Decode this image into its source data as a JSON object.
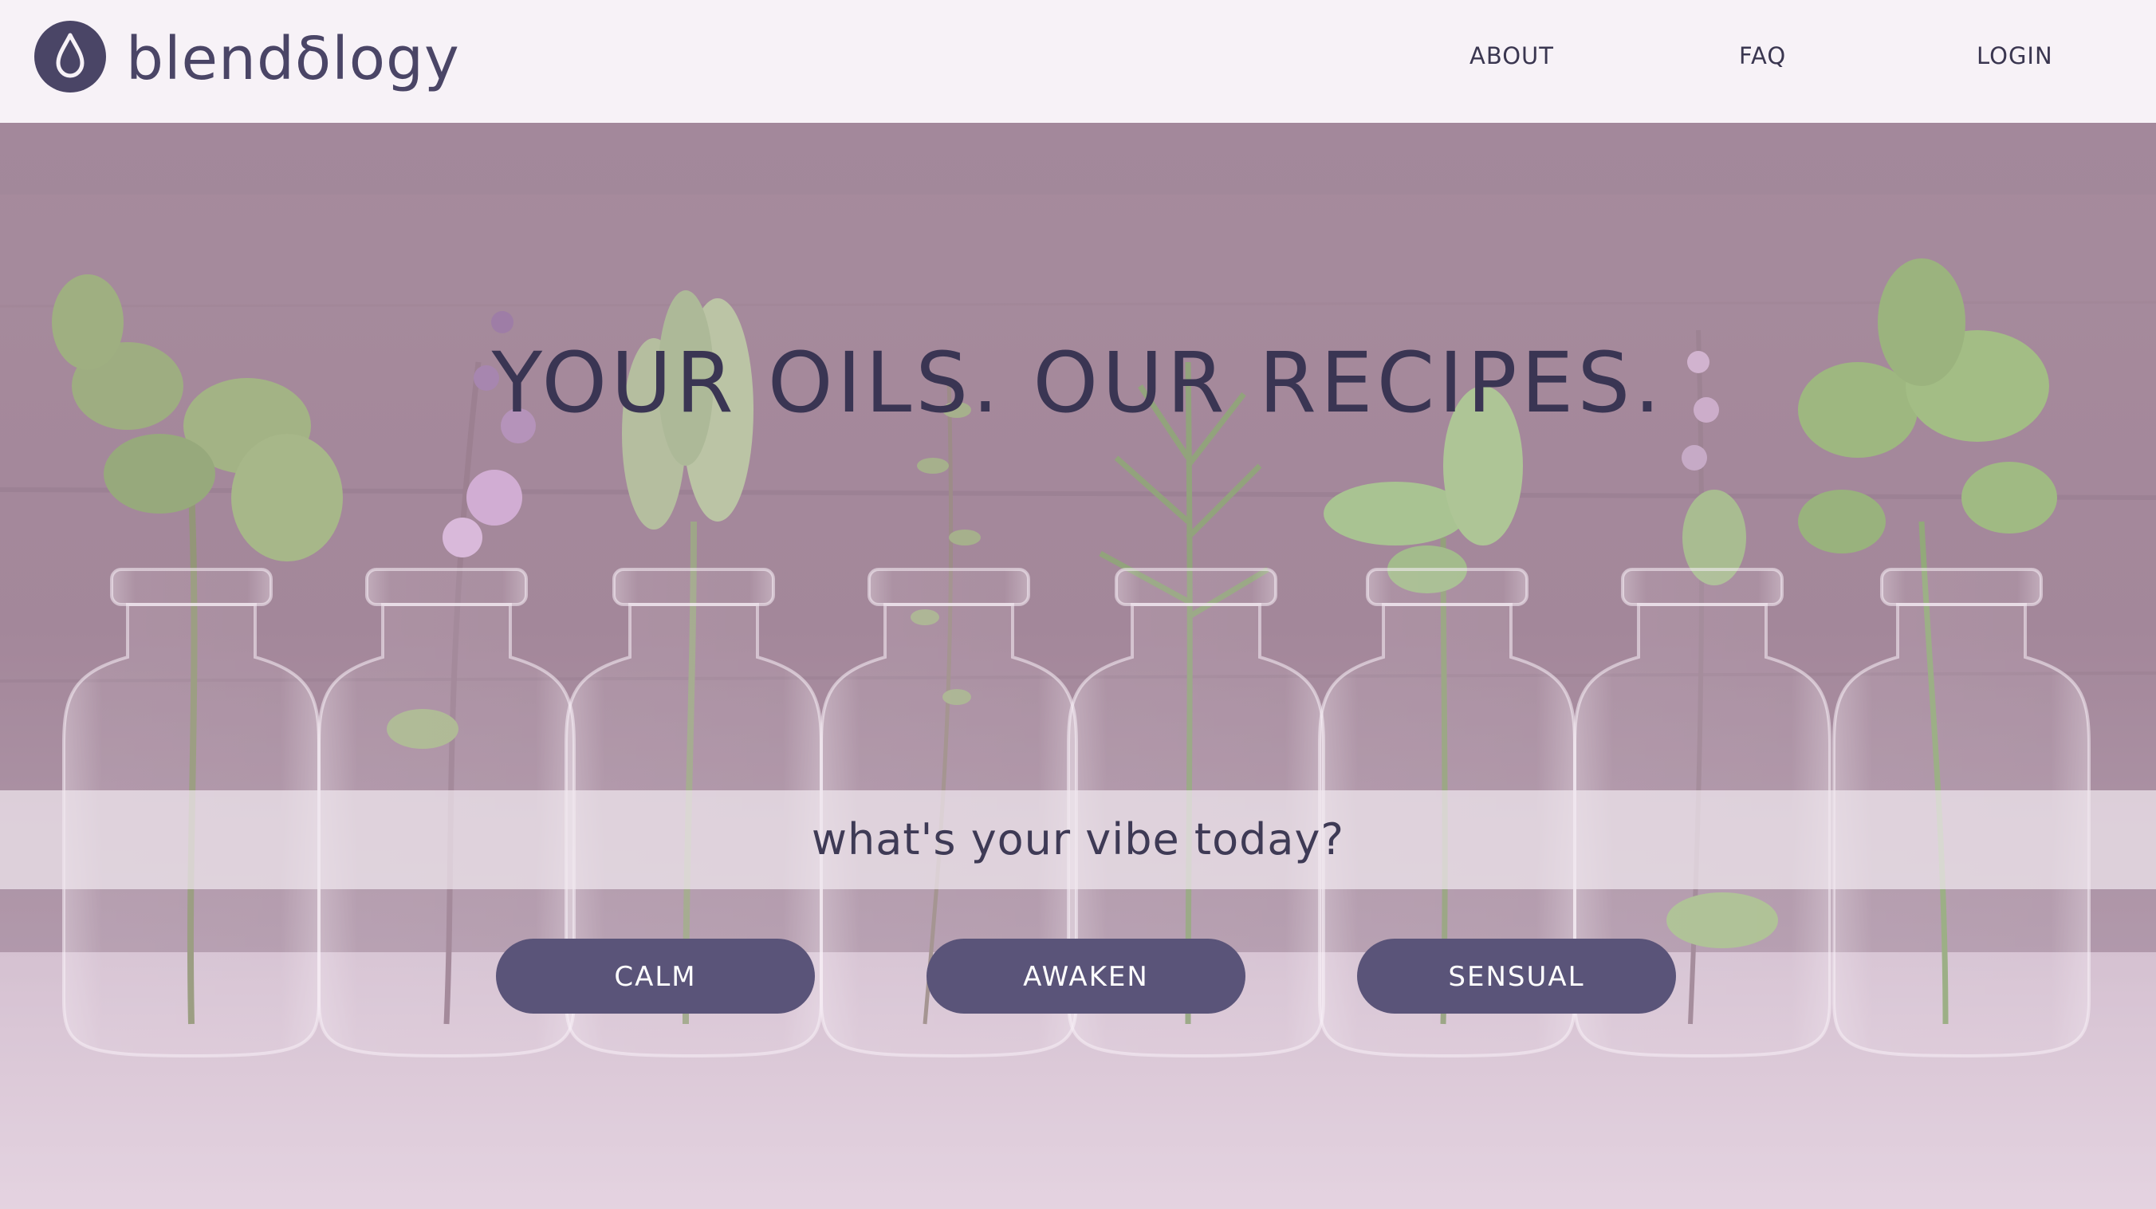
{
  "header": {
    "logo_text": "blendδlogy",
    "logo_icon": "droplet-icon",
    "nav": [
      {
        "label": "ABOUT"
      },
      {
        "label": "FAQ"
      },
      {
        "label": "LOGIN"
      }
    ]
  },
  "hero": {
    "headline": "YOUR OILS. OUR RECIPES.",
    "vibe_prompt": "what's your vibe today?",
    "moods": [
      {
        "label": "CALM"
      },
      {
        "label": "AWAKEN"
      },
      {
        "label": "SENSUAL"
      }
    ]
  },
  "colors": {
    "brand": "#4a4566",
    "button": "#5a5479",
    "header_bg": "#f7f2f7",
    "headline": "#3a3553"
  }
}
